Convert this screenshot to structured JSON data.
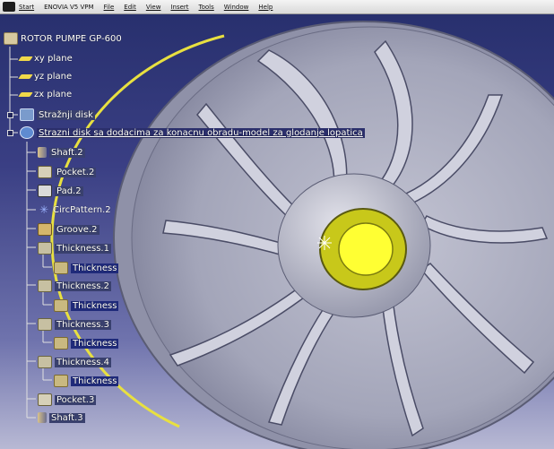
{
  "menubar": {
    "items": [
      "Start",
      "ENOVIA V5 VPM",
      "File",
      "Edit",
      "View",
      "Insert",
      "Tools",
      "Window",
      "Help"
    ]
  },
  "tree": {
    "root": "ROTOR PUMPE GP-600",
    "planes": [
      "xy plane",
      "yz plane",
      "zx plane"
    ],
    "body1": "Stražnji disk",
    "body2": "Strazni disk sa dodacima za konacnu obradu-model za glodanje lopatica",
    "features": [
      {
        "label": "Shaft.2",
        "icon": "shaft-icon"
      },
      {
        "label": "Pocket.2",
        "icon": "pocket-icon"
      },
      {
        "label": "Pad.2",
        "icon": "pad-icon"
      },
      {
        "label": "CircPattern.2",
        "icon": "circpattern-icon"
      },
      {
        "label": "Groove.2",
        "icon": "groove-icon"
      },
      {
        "label": "Thickness.1",
        "icon": "thickness-icon",
        "child": "Thickness"
      },
      {
        "label": "Thickness.2",
        "icon": "thickness-icon",
        "child": "Thickness"
      },
      {
        "label": "Thickness.3",
        "icon": "thickness-icon",
        "child": "Thickness"
      },
      {
        "label": "Thickness.4",
        "icon": "thickness-icon",
        "child": "Thickness"
      },
      {
        "label": "Pocket.3",
        "icon": "pocket-icon"
      },
      {
        "label": "Shaft.3",
        "icon": "shaft-icon"
      }
    ]
  },
  "colors": {
    "background_top": "#28306e",
    "background_bottom": "#b8b9d4",
    "part": "#a9abbe",
    "hub": "#d4d400",
    "edge_highlight": "#e8e040"
  }
}
